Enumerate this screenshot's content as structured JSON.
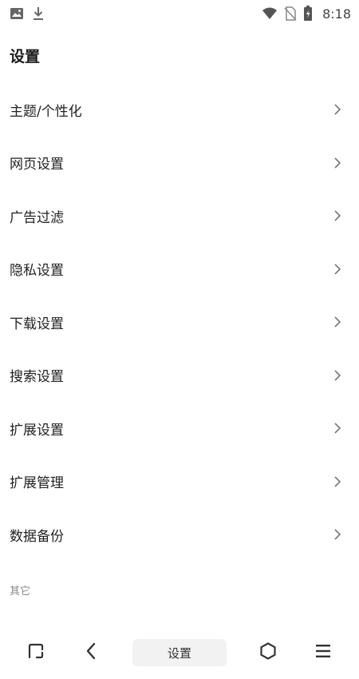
{
  "status_bar": {
    "time": "8:18",
    "icons": [
      "image-icon",
      "download-icon",
      "wifi-icon",
      "no-sim-icon",
      "battery-icon"
    ]
  },
  "page": {
    "title": "设置"
  },
  "settings": {
    "items": [
      {
        "label": "主题/个性化"
      },
      {
        "label": "网页设置"
      },
      {
        "label": "广告过滤"
      },
      {
        "label": "隐私设置"
      },
      {
        "label": "下载设置"
      },
      {
        "label": "搜索设置"
      },
      {
        "label": "扩展设置"
      },
      {
        "label": "扩展管理"
      },
      {
        "label": "数据备份"
      }
    ],
    "section_other": "其它"
  },
  "bottom_bar": {
    "address_label": "设置",
    "icons": [
      "tab-switcher-icon",
      "back-chevron-icon",
      "home-icon",
      "menu-icon"
    ]
  }
}
